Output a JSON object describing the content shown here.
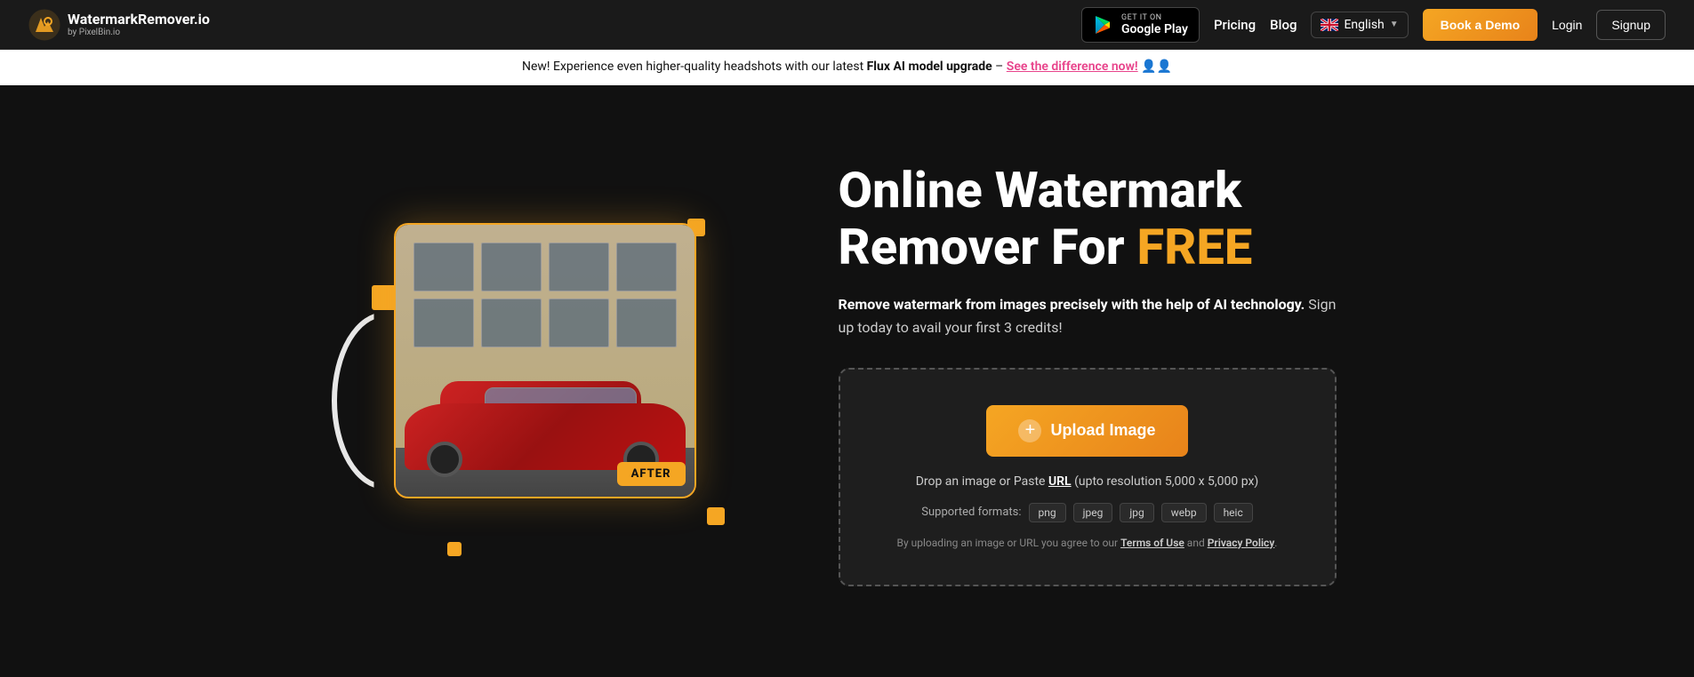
{
  "navbar": {
    "logo_main": "WatermarkRemover.io",
    "logo_sub": "by PixelBin.io",
    "google_play_top": "GET IT ON",
    "google_play_bottom": "Google Play",
    "pricing_label": "Pricing",
    "blog_label": "Blog",
    "language": "English",
    "book_demo_label": "Book a Demo",
    "login_label": "Login",
    "signup_label": "Signup"
  },
  "announcement": {
    "text_before": "New! Experience even higher-quality headshots with our latest ",
    "bold_text": "Flux AI model upgrade",
    "text_dash": " – ",
    "link_text": "See the difference now!",
    "emoji": "👤👤"
  },
  "hero": {
    "title_line1": "Online Watermark",
    "title_line2": "Remover For ",
    "title_free": "FREE",
    "subtitle": "Remove watermark from images precisely with the help of AI technology. Sign up today to avail your first 3 credits!",
    "after_badge": "AFTER"
  },
  "upload": {
    "button_label": "Upload Image",
    "drop_text_before": "Drop an image or Paste ",
    "drop_url_label": "URL",
    "drop_text_after": " (upto resolution 5,000 x 5,000 px)",
    "formats_label": "Supported formats:",
    "formats": [
      "png",
      "jpeg",
      "jpg",
      "webp",
      "heic"
    ],
    "terms_text_before": "By uploading an image or URL you agree to our ",
    "terms_link": "Terms of Use",
    "terms_and": " and ",
    "privacy_link": "Privacy Policy",
    "terms_dot": "."
  },
  "colors": {
    "accent": "#f5a623",
    "pink_link": "#e8438b"
  }
}
